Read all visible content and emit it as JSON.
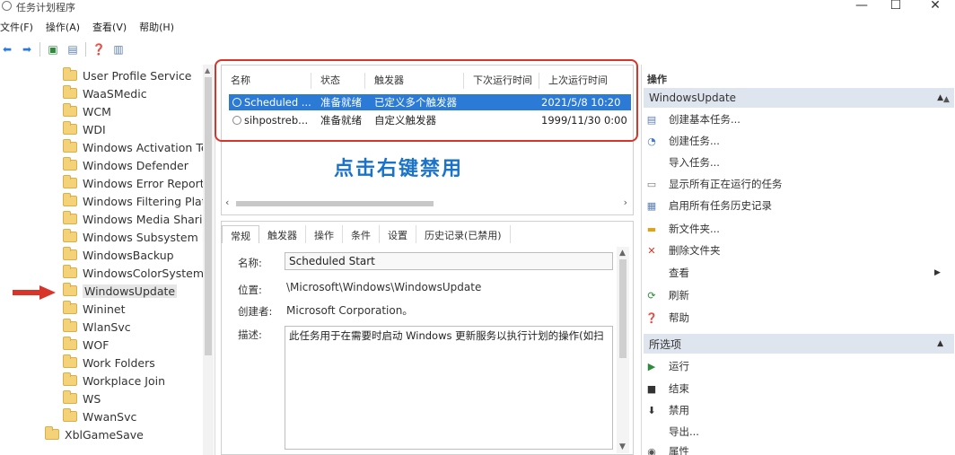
{
  "window": {
    "title": "任务计划程序"
  },
  "menu": [
    "文件(F)",
    "操作(A)",
    "查看(V)",
    "帮助(H)"
  ],
  "tree": {
    "items": [
      "User Profile Service",
      "WaaSMedic",
      "WCM",
      "WDI",
      "Windows Activation Te",
      "Windows Defender",
      "Windows Error Report",
      "Windows Filtering Platf",
      "Windows Media Sharin",
      "Windows Subsystem F",
      "WindowsBackup",
      "WindowsColorSystem",
      "WindowsUpdate",
      "Wininet",
      "WlanSvc",
      "WOF",
      "Work Folders",
      "Workplace Join",
      "WS",
      "WwanSvc",
      "XblGameSave"
    ],
    "selected": "WindowsUpdate"
  },
  "task_list": {
    "columns": [
      "名称",
      "状态",
      "触发器",
      "下次运行时间",
      "上次运行时间"
    ],
    "rows": [
      {
        "name": "Scheduled ...",
        "status": "准备就绪",
        "trigger": "已定义多个触发器",
        "next": "",
        "last": "2021/5/8 10:20"
      },
      {
        "name": "sihpostreb...",
        "status": "准备就绪",
        "trigger": "自定义触发器",
        "next": "",
        "last": "1999/11/30 0:00"
      }
    ]
  },
  "annotation": {
    "text": "点击右键禁用",
    "color": "#1a73c9"
  },
  "details": {
    "tabs": [
      "常规",
      "触发器",
      "操作",
      "条件",
      "设置",
      "历史记录(已禁用)"
    ],
    "name_label": "名称:",
    "name_value": "Scheduled Start",
    "location_label": "位置:",
    "location_value": "\\Microsoft\\Windows\\WindowsUpdate",
    "author_label": "创建者:",
    "author_value": "Microsoft Corporation。",
    "desc_label": "描述:",
    "desc_value": "此任务用于在需要时启动 Windows 更新服务以执行计划的操作(如扫"
  },
  "actions": {
    "title": "操作",
    "section1": "WindowsUpdate",
    "items1": [
      "创建基本任务...",
      "创建任务...",
      "导入任务...",
      "显示所有正在运行的任务",
      "启用所有任务历史记录",
      "新文件夹...",
      "删除文件夹",
      "查看",
      "刷新",
      "帮助"
    ],
    "section2": "所选项",
    "items2": [
      "运行",
      "结束",
      "禁用",
      "导出...",
      "属性"
    ]
  },
  "colors": {
    "selection": "#2b7bd6",
    "highlight_frame": "#d8342a",
    "arrow": "#d8342a"
  }
}
